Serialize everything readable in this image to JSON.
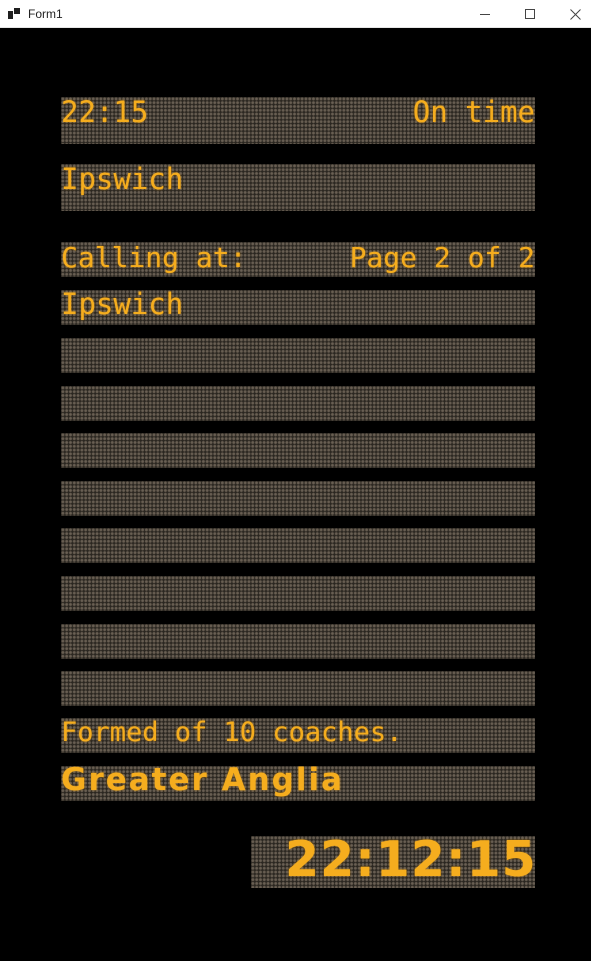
{
  "window": {
    "title": "Form1",
    "icons": {
      "app": "app-icon",
      "minimize": "minimize-icon",
      "maximize": "maximize-icon",
      "close": "close-icon"
    }
  },
  "board": {
    "departure_time": "22:15",
    "status": "On time",
    "destination": "Ipswich",
    "calling_label": "Calling at:",
    "page_indicator": "Page 2 of 2",
    "calling_points": [
      "Ipswich",
      "",
      "",
      "",
      "",
      "",
      "",
      "",
      ""
    ],
    "formation": "Formed of 10 coaches.",
    "operator": "Greater Anglia",
    "clock": "22:12:15"
  },
  "colors": {
    "led_amber": "#f5ad1e",
    "panel_dot": "#5f564b",
    "background": "#000000"
  }
}
